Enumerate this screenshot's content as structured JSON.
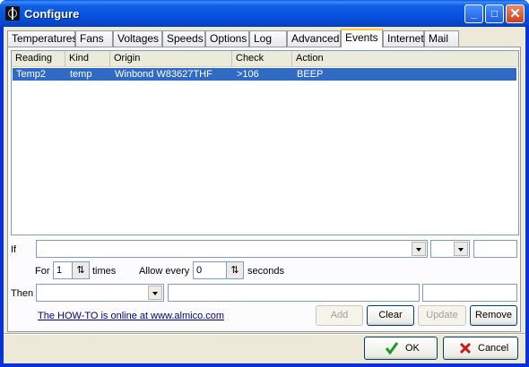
{
  "window": {
    "title": "Configure",
    "minimize": "_",
    "maximize": "□",
    "close": "✕"
  },
  "tabs": [
    {
      "label": "Temperatures"
    },
    {
      "label": "Fans"
    },
    {
      "label": "Voltages"
    },
    {
      "label": "Speeds"
    },
    {
      "label": "Options"
    },
    {
      "label": "Log"
    },
    {
      "label": "Advanced"
    },
    {
      "label": "Events",
      "active": true
    },
    {
      "label": "Internet"
    },
    {
      "label": "Mail"
    }
  ],
  "events": {
    "columns": [
      "Reading",
      "Kind",
      "Origin",
      "Check",
      "Action"
    ],
    "rows": [
      {
        "reading": "Temp2",
        "kind": "temp",
        "origin": "Winbond W83627THF",
        "check": ">106",
        "action": "BEEP",
        "selected": true
      }
    ]
  },
  "if_row": {
    "label": "If",
    "value": "",
    "op": "",
    "threshold": ""
  },
  "for_row": {
    "for_label": "For",
    "for_value": "1",
    "times_label": "times",
    "allow_label": "Allow every",
    "allow_value": "0",
    "seconds_label": "seconds"
  },
  "then_row": {
    "label": "Then",
    "action": "",
    "param1": "",
    "param2": ""
  },
  "howto_link": "The HOW-TO is online at www.almico.com",
  "buttons": {
    "add": "Add",
    "clear": "Clear",
    "update": "Update",
    "remove": "Remove",
    "ok": "OK",
    "cancel": "Cancel"
  },
  "icons": {
    "app": "speedfan-icon",
    "ok": "check-icon",
    "cancel": "x-icon",
    "spin": "spin-arrows-icon"
  },
  "colors": {
    "titlebar": "#0752dd",
    "selection": "#316ac5",
    "active_tab_accent": "#ffc83c"
  }
}
